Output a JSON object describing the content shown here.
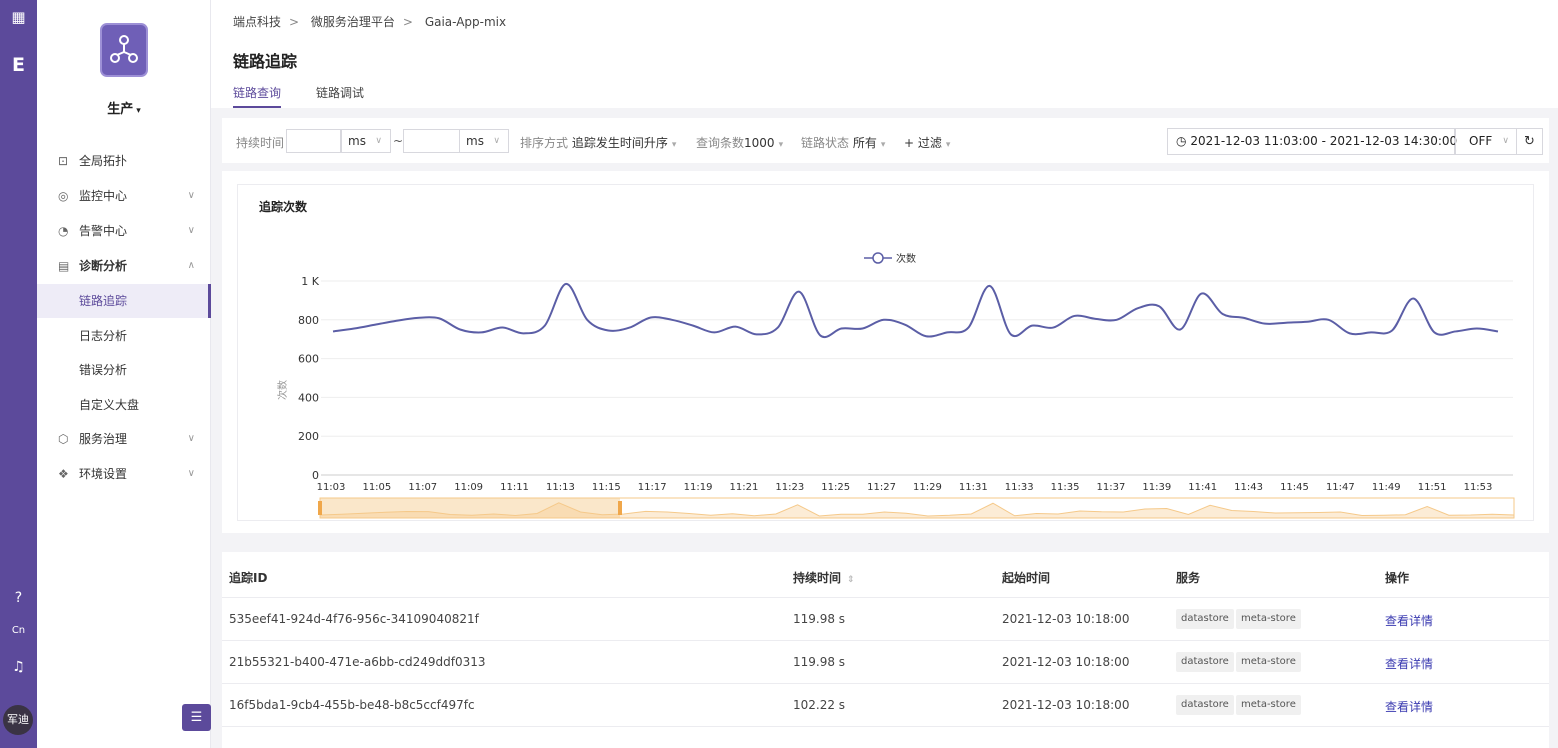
{
  "rail": {
    "avatar_text": "军迪",
    "icons": [
      "grid-icon",
      "logo-e-icon",
      "help-icon",
      "language-icon",
      "bell-icon"
    ]
  },
  "sidebar": {
    "env_label": "生产",
    "items": [
      {
        "label": "全局拓扑",
        "icon": "topology-icon"
      },
      {
        "label": "监控中心",
        "icon": "monitor-icon"
      },
      {
        "label": "告警中心",
        "icon": "alarm-icon"
      },
      {
        "label": "诊断分析",
        "icon": "diagnosis-icon"
      },
      {
        "label": "链路追踪"
      },
      {
        "label": "日志分析"
      },
      {
        "label": "错误分析"
      },
      {
        "label": "自定义大盘"
      },
      {
        "label": "服务治理",
        "icon": "service-icon"
      },
      {
        "label": "环境设置",
        "icon": "settings-icon"
      }
    ]
  },
  "header": {
    "breadcrumb": [
      "端点科技",
      "微服务治理平台",
      "Gaia-App-mix"
    ],
    "title": "链路追踪",
    "tabs": [
      "链路查询",
      "链路调试"
    ]
  },
  "filters": {
    "duration_label": "持续时间",
    "unit_ms": "ms",
    "range_sep": "~",
    "sort_label": "排序方式",
    "sort_value": "追踪发生时间升序",
    "count_label": "查询条数",
    "count_value": "1000",
    "status_label": "链路状态",
    "status_value": "所有",
    "add_filter": "+ 过滤",
    "time_range": "2021-12-03 11:03:00 - 2021-12-03 14:30:00",
    "refresh_mode": "OFF"
  },
  "colors": {
    "accent": "#5c4a9b",
    "line": "#5b5ea6",
    "brush": "#f5c98a"
  },
  "chart_data": {
    "type": "line",
    "title": "追踪次数",
    "ylabel": "次数",
    "legend": "次数",
    "legend_position": "top-center",
    "ylim": [
      0,
      1000
    ],
    "y_ticks": [
      "0",
      "200",
      "400",
      "600",
      "800",
      "1 K"
    ],
    "x_ticks": [
      "11:03",
      "11:05",
      "11:07",
      "11:09",
      "11:11",
      "11:13",
      "11:15",
      "11:17",
      "11:19",
      "11:21",
      "11:23",
      "11:25",
      "11:27",
      "11:29",
      "11:31",
      "11:33",
      "11:35",
      "11:37",
      "11:39",
      "11:41",
      "11:43",
      "11:45",
      "11:47",
      "11:49",
      "11:51",
      "11:53"
    ],
    "series": [
      {
        "name": "次数",
        "values": [
          740,
          755,
          775,
          795,
          810,
          808,
          750,
          735,
          760,
          730,
          770,
          985,
          800,
          745,
          760,
          812,
          800,
          770,
          735,
          765,
          725,
          760,
          945,
          720,
          755,
          755,
          800,
          775,
          715,
          735,
          760,
          975,
          725,
          770,
          760,
          820,
          805,
          800,
          860,
          870,
          750,
          935,
          830,
          810,
          780,
          785,
          790,
          800,
          730,
          735,
          745,
          910,
          735,
          740,
          755,
          740
        ]
      }
    ],
    "grid": true
  },
  "table": {
    "headers": [
      "追踪ID",
      "持续时间",
      "起始时间",
      "服务",
      "操作"
    ],
    "rows": [
      {
        "id": "535eef41-924d-4f76-956c-34109040821f",
        "duration": "119.98 s",
        "start": "2021-12-03 10:18:00",
        "services": [
          "datastore",
          "meta-store"
        ],
        "action": "查看详情"
      },
      {
        "id": "21b55321-b400-471e-a6bb-cd249ddf0313",
        "duration": "119.98 s",
        "start": "2021-12-03 10:18:00",
        "services": [
          "datastore",
          "meta-store"
        ],
        "action": "查看详情"
      },
      {
        "id": "16f5bda1-9cb4-455b-be48-b8c5ccf497fc",
        "duration": "102.22 s",
        "start": "2021-12-03 10:18:00",
        "services": [
          "datastore",
          "meta-store"
        ],
        "action": "查看详情"
      }
    ]
  }
}
